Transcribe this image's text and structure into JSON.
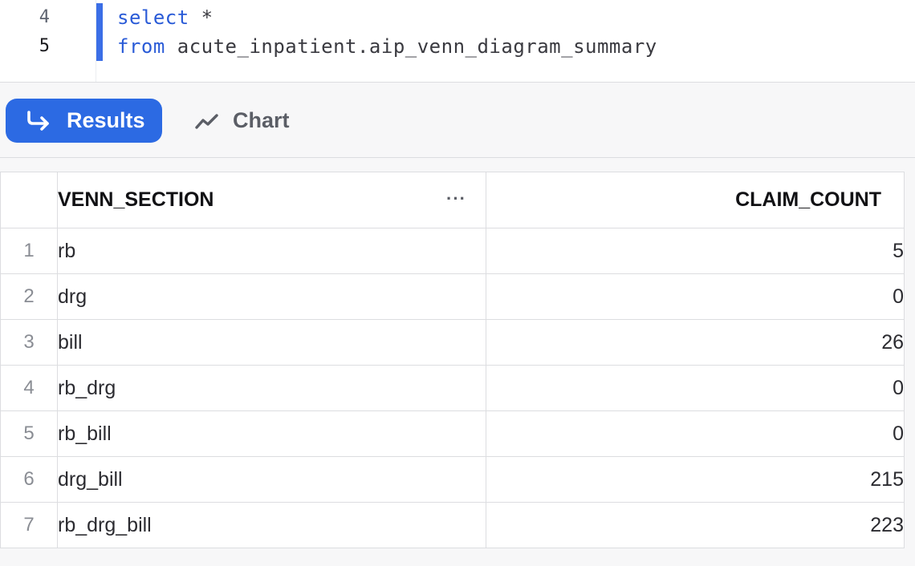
{
  "editor": {
    "lines": [
      {
        "number": "4",
        "keyword": "select",
        "rest": " *"
      },
      {
        "number": "5",
        "keyword": "from",
        "rest": " acute_inpatient.aip_venn_diagram_summary"
      }
    ]
  },
  "tabs": {
    "results_label": "Results",
    "chart_label": "Chart",
    "results_icon": "return-arrow-icon",
    "chart_icon": "line-chart-icon"
  },
  "table": {
    "columns": [
      "VENN_SECTION",
      "CLAIM_COUNT"
    ],
    "column_menu": "···",
    "rows": [
      {
        "index": "1",
        "venn_section": "rb",
        "claim_count": "5"
      },
      {
        "index": "2",
        "venn_section": "drg",
        "claim_count": "0"
      },
      {
        "index": "3",
        "venn_section": "bill",
        "claim_count": "26"
      },
      {
        "index": "4",
        "venn_section": "rb_drg",
        "claim_count": "0"
      },
      {
        "index": "5",
        "venn_section": "rb_bill",
        "claim_count": "0"
      },
      {
        "index": "6",
        "venn_section": "drg_bill",
        "claim_count": "215"
      },
      {
        "index": "7",
        "venn_section": "rb_drg_bill",
        "claim_count": "223"
      }
    ]
  },
  "colors": {
    "accent": "#2c6ae3",
    "keyword": "#2a5bd7",
    "active_line_marker": "#3b6ee6"
  }
}
